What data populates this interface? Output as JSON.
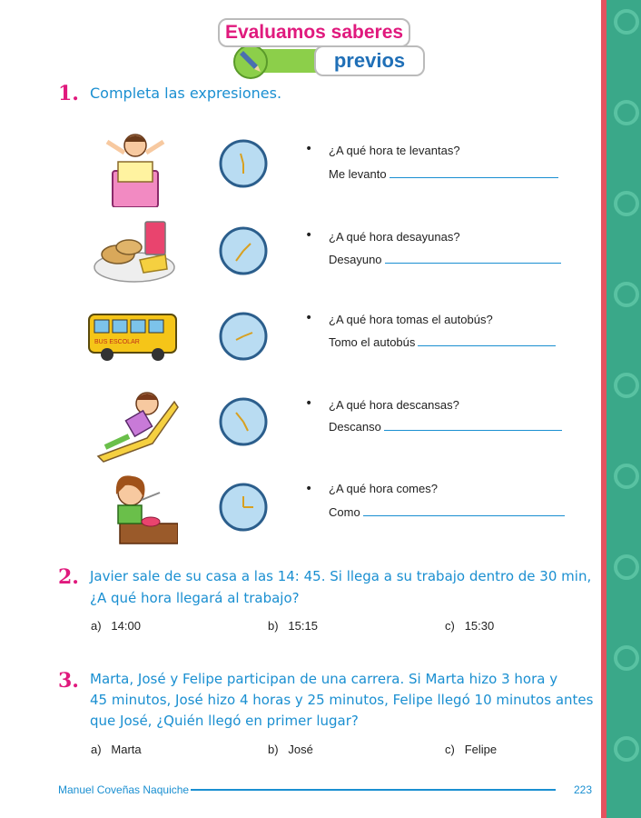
{
  "header": {
    "title": "Evaluamos saberes",
    "subtitle": "previos"
  },
  "q1": {
    "number": "1.",
    "prompt": "Completa las expresiones.",
    "items": [
      {
        "image": "girl-waking-up",
        "question": "¿A qué hora te levantas?",
        "answer_prefix": "Me levanto"
      },
      {
        "image": "breakfast-plate",
        "question": "¿A qué hora desayunas?",
        "answer_prefix": "Desayuno"
      },
      {
        "image": "school-bus",
        "question": "¿A qué hora tomas el autobús?",
        "answer_prefix": "Tomo el autobús",
        "bus_label": "BUS ESCOLAR"
      },
      {
        "image": "girl-resting",
        "question": "¿A qué hora descansas?",
        "answer_prefix": "Descanso"
      },
      {
        "image": "girl-eating",
        "question": "¿A qué hora comes?",
        "answer_prefix": "Como"
      }
    ]
  },
  "q2": {
    "number": "2.",
    "text_line1": "Javier sale de su casa a las 14: 45. Si llega a su trabajo dentro de 30 min,",
    "text_line2": "¿A qué hora llegará al trabajo?",
    "options": [
      {
        "letter": "a)",
        "value": "14:00"
      },
      {
        "letter": "b)",
        "value": "15:15"
      },
      {
        "letter": "c)",
        "value": "15:30"
      }
    ]
  },
  "q3": {
    "number": "3.",
    "text_line1": "Marta, José y Felipe participan de una carrera. Si Marta hizo 3 hora y",
    "text_line2": "45 minutos, José hizo 4 horas y 25 minutos, Felipe llegó 10 minutos antes",
    "text_line3": "que José, ¿Quién llegó en primer lugar?",
    "options": [
      {
        "letter": "a)",
        "value": "Marta"
      },
      {
        "letter": "b)",
        "value": "José"
      },
      {
        "letter": "c)",
        "value": "Felipe"
      }
    ]
  },
  "footer": {
    "author": "Manuel Coveñas Naquiche",
    "page": "223"
  },
  "colors": {
    "accent_pink": "#e0197d",
    "accent_blue": "#1a8fd1",
    "strip_green": "#3aa889",
    "clock_face": "#b9dcf2"
  }
}
